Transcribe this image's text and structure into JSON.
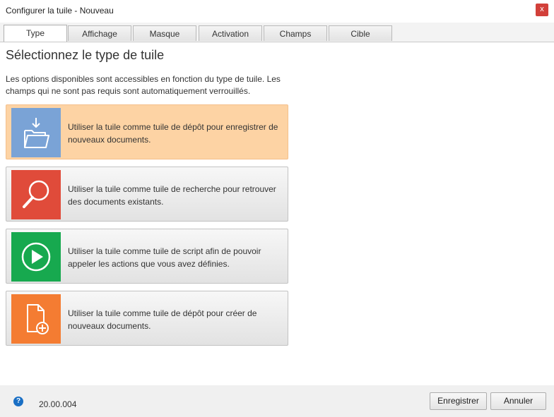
{
  "window": {
    "title": "Configurer la tuile - Nouveau",
    "close_label": "x"
  },
  "tabs": [
    {
      "label": "Type",
      "active": true
    },
    {
      "label": "Affichage",
      "active": false
    },
    {
      "label": "Masque",
      "active": false
    },
    {
      "label": "Activation",
      "active": false
    },
    {
      "label": "Champs",
      "active": false
    },
    {
      "label": "Cible",
      "active": false
    }
  ],
  "main": {
    "heading": "Sélectionnez le type de tuile",
    "description": "Les options disponibles sont accessibles en fonction du type de tuile. Les champs qui ne sont pas requis sont automatiquement verrouillés."
  },
  "tiles": [
    {
      "text": "Utiliser la tuile comme tuile de dépôt pour enregistrer de nouveaux documents.",
      "icon": "folder-download-icon",
      "color": "#7aa3d6",
      "selected": true
    },
    {
      "text": "Utiliser la tuile comme tuile de recherche pour retrouver des documents existants.",
      "icon": "search-icon",
      "color": "#e04b3a",
      "selected": false
    },
    {
      "text": "Utiliser la tuile comme tuile de script afin de pouvoir appeler les actions que vous avez définies.",
      "icon": "play-icon",
      "color": "#17a94f",
      "selected": false
    },
    {
      "text": "Utiliser la tuile comme tuile de dépôt pour créer de nouveaux documents.",
      "icon": "new-document-icon",
      "color": "#f47c32",
      "selected": false
    }
  ],
  "footer": {
    "help_label": "?",
    "version": "20.00.004",
    "save_label": "Enregistrer",
    "cancel_label": "Annuler"
  },
  "colors": {
    "selected_tile_bg": "#fdd3a4",
    "close_button": "#d2403a",
    "help_icon": "#1a6fc4"
  }
}
